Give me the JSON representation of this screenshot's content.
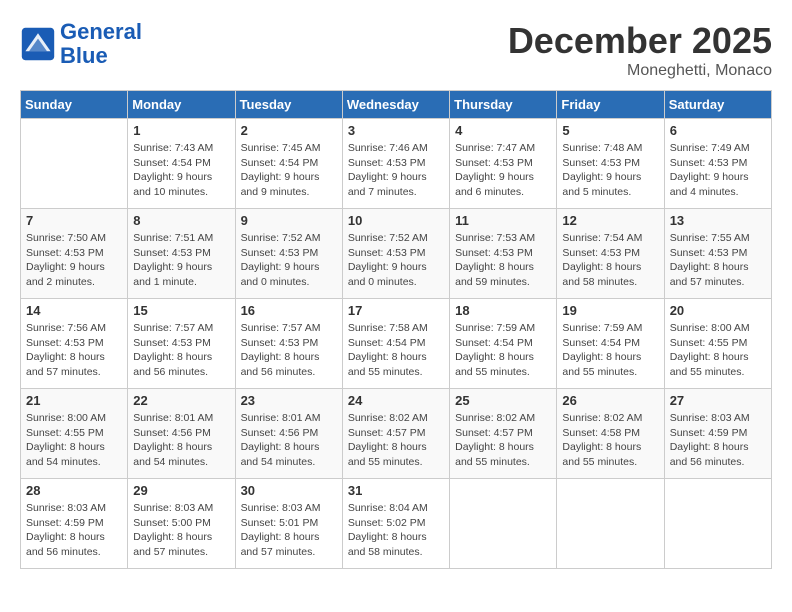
{
  "header": {
    "logo_line1": "General",
    "logo_line2": "Blue",
    "month": "December 2025",
    "location": "Moneghetti, Monaco"
  },
  "days_of_week": [
    "Sunday",
    "Monday",
    "Tuesday",
    "Wednesday",
    "Thursday",
    "Friday",
    "Saturday"
  ],
  "weeks": [
    [
      {
        "day": "",
        "info": ""
      },
      {
        "day": "1",
        "info": "Sunrise: 7:43 AM\nSunset: 4:54 PM\nDaylight: 9 hours\nand 10 minutes."
      },
      {
        "day": "2",
        "info": "Sunrise: 7:45 AM\nSunset: 4:54 PM\nDaylight: 9 hours\nand 9 minutes."
      },
      {
        "day": "3",
        "info": "Sunrise: 7:46 AM\nSunset: 4:53 PM\nDaylight: 9 hours\nand 7 minutes."
      },
      {
        "day": "4",
        "info": "Sunrise: 7:47 AM\nSunset: 4:53 PM\nDaylight: 9 hours\nand 6 minutes."
      },
      {
        "day": "5",
        "info": "Sunrise: 7:48 AM\nSunset: 4:53 PM\nDaylight: 9 hours\nand 5 minutes."
      },
      {
        "day": "6",
        "info": "Sunrise: 7:49 AM\nSunset: 4:53 PM\nDaylight: 9 hours\nand 4 minutes."
      }
    ],
    [
      {
        "day": "7",
        "info": "Sunrise: 7:50 AM\nSunset: 4:53 PM\nDaylight: 9 hours\nand 2 minutes."
      },
      {
        "day": "8",
        "info": "Sunrise: 7:51 AM\nSunset: 4:53 PM\nDaylight: 9 hours\nand 1 minute."
      },
      {
        "day": "9",
        "info": "Sunrise: 7:52 AM\nSunset: 4:53 PM\nDaylight: 9 hours\nand 0 minutes."
      },
      {
        "day": "10",
        "info": "Sunrise: 7:52 AM\nSunset: 4:53 PM\nDaylight: 9 hours\nand 0 minutes."
      },
      {
        "day": "11",
        "info": "Sunrise: 7:53 AM\nSunset: 4:53 PM\nDaylight: 8 hours\nand 59 minutes."
      },
      {
        "day": "12",
        "info": "Sunrise: 7:54 AM\nSunset: 4:53 PM\nDaylight: 8 hours\nand 58 minutes."
      },
      {
        "day": "13",
        "info": "Sunrise: 7:55 AM\nSunset: 4:53 PM\nDaylight: 8 hours\nand 57 minutes."
      }
    ],
    [
      {
        "day": "14",
        "info": "Sunrise: 7:56 AM\nSunset: 4:53 PM\nDaylight: 8 hours\nand 57 minutes."
      },
      {
        "day": "15",
        "info": "Sunrise: 7:57 AM\nSunset: 4:53 PM\nDaylight: 8 hours\nand 56 minutes."
      },
      {
        "day": "16",
        "info": "Sunrise: 7:57 AM\nSunset: 4:53 PM\nDaylight: 8 hours\nand 56 minutes."
      },
      {
        "day": "17",
        "info": "Sunrise: 7:58 AM\nSunset: 4:54 PM\nDaylight: 8 hours\nand 55 minutes."
      },
      {
        "day": "18",
        "info": "Sunrise: 7:59 AM\nSunset: 4:54 PM\nDaylight: 8 hours\nand 55 minutes."
      },
      {
        "day": "19",
        "info": "Sunrise: 7:59 AM\nSunset: 4:54 PM\nDaylight: 8 hours\nand 55 minutes."
      },
      {
        "day": "20",
        "info": "Sunrise: 8:00 AM\nSunset: 4:55 PM\nDaylight: 8 hours\nand 55 minutes."
      }
    ],
    [
      {
        "day": "21",
        "info": "Sunrise: 8:00 AM\nSunset: 4:55 PM\nDaylight: 8 hours\nand 54 minutes."
      },
      {
        "day": "22",
        "info": "Sunrise: 8:01 AM\nSunset: 4:56 PM\nDaylight: 8 hours\nand 54 minutes."
      },
      {
        "day": "23",
        "info": "Sunrise: 8:01 AM\nSunset: 4:56 PM\nDaylight: 8 hours\nand 54 minutes."
      },
      {
        "day": "24",
        "info": "Sunrise: 8:02 AM\nSunset: 4:57 PM\nDaylight: 8 hours\nand 55 minutes."
      },
      {
        "day": "25",
        "info": "Sunrise: 8:02 AM\nSunset: 4:57 PM\nDaylight: 8 hours\nand 55 minutes."
      },
      {
        "day": "26",
        "info": "Sunrise: 8:02 AM\nSunset: 4:58 PM\nDaylight: 8 hours\nand 55 minutes."
      },
      {
        "day": "27",
        "info": "Sunrise: 8:03 AM\nSunset: 4:59 PM\nDaylight: 8 hours\nand 56 minutes."
      }
    ],
    [
      {
        "day": "28",
        "info": "Sunrise: 8:03 AM\nSunset: 4:59 PM\nDaylight: 8 hours\nand 56 minutes."
      },
      {
        "day": "29",
        "info": "Sunrise: 8:03 AM\nSunset: 5:00 PM\nDaylight: 8 hours\nand 57 minutes."
      },
      {
        "day": "30",
        "info": "Sunrise: 8:03 AM\nSunset: 5:01 PM\nDaylight: 8 hours\nand 57 minutes."
      },
      {
        "day": "31",
        "info": "Sunrise: 8:04 AM\nSunset: 5:02 PM\nDaylight: 8 hours\nand 58 minutes."
      },
      {
        "day": "",
        "info": ""
      },
      {
        "day": "",
        "info": ""
      },
      {
        "day": "",
        "info": ""
      }
    ]
  ]
}
